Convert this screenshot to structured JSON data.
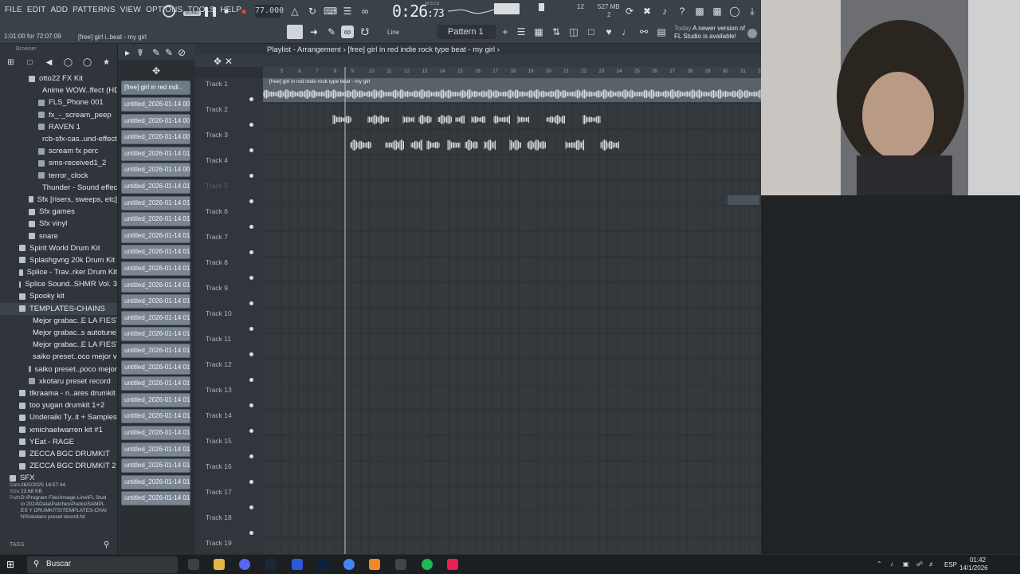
{
  "menu": {
    "items": [
      "FILE",
      "EDIT",
      "ADD",
      "PATTERNS",
      "VIEW",
      "OPTIONS",
      "TOOLS",
      "HELP"
    ]
  },
  "transport": {
    "song_label": "SONG",
    "tempo": "77.000",
    "time": "0:26",
    "time_sub": ":73",
    "mcs": "M:S:CS",
    "cpu": "12",
    "mem": "527 MB",
    "voices": "2"
  },
  "hint": {
    "time": "1:01:00 for 72:07:09",
    "title": "[free] girl i..beat - my girl"
  },
  "toolbar": {
    "snap": "Line",
    "pattern": "Pattern 1"
  },
  "news": {
    "today": "Today",
    "message": "A newer version of FL Studio is available!"
  },
  "browser": {
    "title": "Browser",
    "items": [
      {
        "label": "otto22 FX Kit",
        "level": 2,
        "folder": true
      },
      {
        "label": "Anime WOW..ffect (HD)",
        "level": 3
      },
      {
        "label": "FLS_Phone 001",
        "level": 3
      },
      {
        "label": "fx_-_scream_peep",
        "level": 3
      },
      {
        "label": "RAVEN 1",
        "level": 3
      },
      {
        "label": "rcb-sfx-cas..und-effects",
        "level": 3
      },
      {
        "label": "scream fx perc",
        "level": 3
      },
      {
        "label": "sms-received1_2",
        "level": 3
      },
      {
        "label": "terror_clock",
        "level": 3
      },
      {
        "label": "Thunder - Sound effect",
        "level": 3
      },
      {
        "label": "Sfx [risers, sweeps, etc]",
        "level": 2,
        "folder": true
      },
      {
        "label": "Sfx games",
        "level": 2,
        "folder": true
      },
      {
        "label": "Sfx vinyl",
        "level": 2,
        "folder": true
      },
      {
        "label": "snare",
        "level": 2,
        "folder": true
      },
      {
        "label": "Spirit World Drum Kit",
        "level": 1,
        "folder": true
      },
      {
        "label": "Splashgvng 20k Drum Kit",
        "level": 1,
        "folder": true
      },
      {
        "label": "Splice - Trav..rker Drum Kit",
        "level": 1,
        "folder": true
      },
      {
        "label": "Splice Sound..SHMR Vol. 3",
        "level": 1,
        "folder": true
      },
      {
        "label": "Spooky kit",
        "level": 1,
        "folder": true
      },
      {
        "label": "TEMPLATES-CHAINS",
        "level": 1,
        "folder": true,
        "sel": true
      },
      {
        "label": "Mejor grabac..E LA FIESTA",
        "level": 2
      },
      {
        "label": "Mejor grabac..s autotune)",
        "level": 2
      },
      {
        "label": "Mejor grabac..E LA FIESTA",
        "level": 2
      },
      {
        "label": "saiko preset..oco mejor v2",
        "level": 2
      },
      {
        "label": "saiko preset..poco mejor",
        "level": 2
      },
      {
        "label": "xkotaru preset record",
        "level": 2
      },
      {
        "label": "tlkraama - n..ares drumkit",
        "level": 1,
        "folder": true
      },
      {
        "label": "too yugan drumkit 1+2",
        "level": 1,
        "folder": true
      },
      {
        "label": "Underaiki Ty..it + Samples",
        "level": 1,
        "folder": true
      },
      {
        "label": "xmichaelwarren kit #1",
        "level": 1,
        "folder": true
      },
      {
        "label": "YEat - RAGE",
        "level": 1,
        "folder": true
      },
      {
        "label": "ZECCA BGC DRUMKIT",
        "level": 1,
        "folder": true
      },
      {
        "label": "ZECCA BGC DRUMKIT 2",
        "level": 1,
        "folder": true
      },
      {
        "label": "SFX",
        "level": 0,
        "folder": true
      }
    ],
    "meta": {
      "date": "26/2/2025 18:57:44",
      "size": "23.68 KB",
      "path": "D:\\Program Files\\Image-Line\\FL Studio 2024\\Data\\Patches\\Packs\\SAMPLES Y DRUMKITS\\TEMPLATES-CHAINS\\xkotaru preset record.fst"
    },
    "meta_labels": {
      "date": "Date",
      "size": "Size",
      "path": "Path"
    },
    "tags": "TAGS"
  },
  "picker": {
    "first": "[free] girl in red  indi..",
    "clips": [
      "untitled_2026-01-14 00-..",
      "untitled_2026-01-14 00-..",
      "untitled_2026-01-14 00-..",
      "untitled_2026-01-14 01-..",
      "untitled_2026-01-14 00-..",
      "untitled_2026-01-14 01-..",
      "untitled_2026-01-14 01-..",
      "untitled_2026-01-14 01-..",
      "untitled_2026-01-14 01-..",
      "untitled_2026-01-14 01-..",
      "untitled_2026-01-14 01-..",
      "untitled_2026-01-14 01-..",
      "untitled_2026-01-14 01-..",
      "untitled_2026-01-14 01-..",
      "untitled_2026-01-14 01-..",
      "untitled_2026-01-14 01-..",
      "untitled_2026-01-14 01-..",
      "untitled_2026-01-14 01-..",
      "untitled_2026-01-14 01-..",
      "untitled_2026-01-14 01-..",
      "untitled_2026-01-14 01-..",
      "untitled_2026-01-14 01-..",
      "untitled_2026-01-14 01-..",
      "untitled_2026-01-14 01-..",
      "untitled_2026-01-14 01-.."
    ]
  },
  "playlist": {
    "header": "Playlist - Arrangement  ›  [free] girl in red  indie rock type beat - my girl  ›",
    "clip1_label": "[free] girl in red  indie rock type beat - my girl",
    "tracks": [
      "Track 1",
      "Track 2",
      "Track 3",
      "Track 4",
      "Track 5",
      "Track 6",
      "Track 7",
      "Track 8",
      "Track 9",
      "Track 10",
      "Track 11",
      "Track 12",
      "Track 13",
      "Track 14",
      "Track 15",
      "Track 16",
      "Track 17",
      "Track 18",
      "Track 19"
    ],
    "ruler": [
      "5",
      "6",
      "7",
      "8",
      "9",
      "10",
      "11",
      "12",
      "13",
      "14",
      "15",
      "16",
      "17",
      "18",
      "19",
      "20",
      "21",
      "22",
      "23",
      "24",
      "25",
      "26",
      "27",
      "28",
      "29",
      "30",
      "31",
      "32"
    ]
  },
  "taskbar": {
    "search": "Buscar",
    "lang": "ESP",
    "time": "01:42",
    "date": "14/1/2026"
  },
  "colors": {
    "accent": "#7a8591",
    "bg": "#34393e",
    "record": "#e0463c"
  }
}
